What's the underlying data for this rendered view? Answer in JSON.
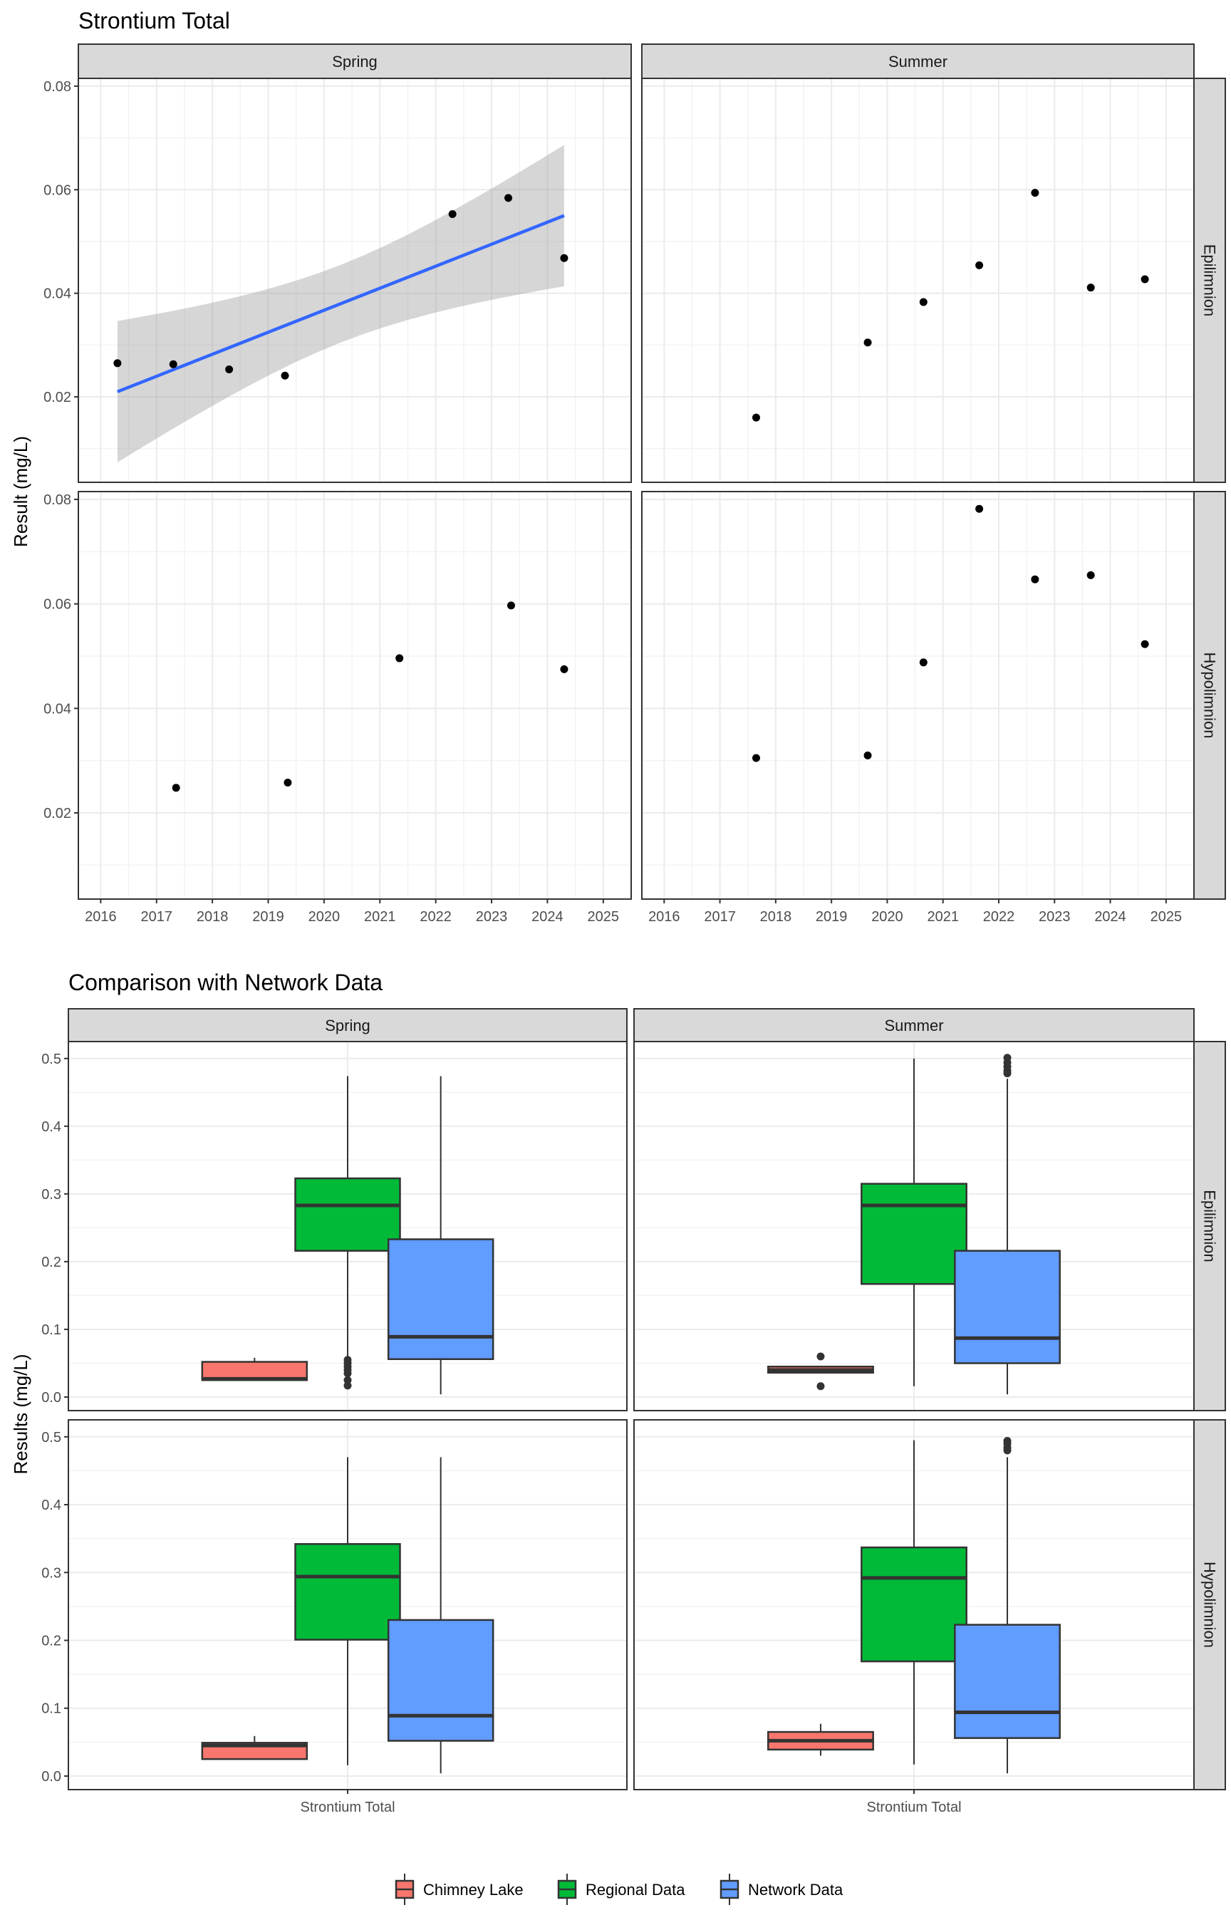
{
  "chart_data": [
    {
      "type": "scatter",
      "title": "Strontium Total",
      "ylabel": "Result (mg/L)",
      "xlabel": "",
      "xlim": [
        2015.6,
        2025.5
      ],
      "ylim": [
        0.0035,
        0.0815
      ],
      "x_ticks": [
        "2016",
        "2017",
        "2018",
        "2019",
        "2020",
        "2021",
        "2022",
        "2023",
        "2024",
        "2025"
      ],
      "y_ticks": [
        "0.02",
        "0.04",
        "0.06",
        "0.08"
      ],
      "grid": true,
      "col_facets": [
        "Spring",
        "Summer"
      ],
      "row_facets": [
        "Epilimnion",
        "Hypolimnion"
      ],
      "panels": [
        {
          "col": "Spring",
          "row": "Epilimnion",
          "points": [
            [
              2016.3,
              0.0265
            ],
            [
              2017.3,
              0.0263
            ],
            [
              2018.3,
              0.0253
            ],
            [
              2019.3,
              0.0241
            ],
            [
              2022.3,
              0.0553
            ],
            [
              2023.3,
              0.0584
            ],
            [
              2024.3,
              0.0468
            ]
          ],
          "trend": {
            "method": "lm",
            "color": "#3366FF",
            "x": [
              2016.3,
              2024.3
            ],
            "y": [
              0.021,
              0.055
            ],
            "ci_lower": [
              0.0077,
              0.041
            ],
            "ci_upper": [
              0.0345,
              0.0688
            ],
            "ci_mid": [
              [
                2020.3,
                0.0305,
                0.0455
              ]
            ]
          }
        },
        {
          "col": "Summer",
          "row": "Epilimnion",
          "points": [
            [
              2017.65,
              0.016
            ],
            [
              2019.65,
              0.0305
            ],
            [
              2020.65,
              0.0383
            ],
            [
              2021.65,
              0.0454
            ],
            [
              2022.65,
              0.0594
            ],
            [
              2023.65,
              0.0411
            ],
            [
              2024.62,
              0.0427
            ]
          ]
        },
        {
          "col": "Spring",
          "row": "Hypolimnion",
          "points": [
            [
              2017.35,
              0.0248
            ],
            [
              2019.35,
              0.0258
            ],
            [
              2021.35,
              0.0496
            ],
            [
              2023.35,
              0.0597
            ],
            [
              2024.3,
              0.0475
            ]
          ]
        },
        {
          "col": "Summer",
          "row": "Hypolimnion",
          "points": [
            [
              2017.65,
              0.0305
            ],
            [
              2019.65,
              0.031
            ],
            [
              2020.65,
              0.0488
            ],
            [
              2021.65,
              0.0782
            ],
            [
              2022.65,
              0.0647
            ],
            [
              2023.65,
              0.0655
            ],
            [
              2024.62,
              0.0523
            ]
          ]
        }
      ]
    },
    {
      "type": "box",
      "title": "Comparison with Network Data",
      "ylabel": "Results (mg/L)",
      "xlabel": "",
      "categories": [
        "Strontium Total"
      ],
      "ylim": [
        -0.02,
        0.525
      ],
      "y_ticks": [
        "0.0",
        "0.1",
        "0.2",
        "0.3",
        "0.4",
        "0.5"
      ],
      "grid": true,
      "col_facets": [
        "Spring",
        "Summer"
      ],
      "row_facets": [
        "Epilimnion",
        "Hypolimnion"
      ],
      "legend": {
        "position": "bottom",
        "entries": [
          {
            "name": "Chimney Lake",
            "color": "#F8766D"
          },
          {
            "name": "Regional Data",
            "color": "#00BA38"
          },
          {
            "name": "Network Data",
            "color": "#619CFF"
          }
        ]
      },
      "panels": [
        {
          "col": "Spring",
          "row": "Epilimnion",
          "series": [
            {
              "name": "Chimney Lake",
              "min": 0.025,
              "q1": 0.025,
              "median": 0.027,
              "q3": 0.052,
              "max": 0.058,
              "outliers": []
            },
            {
              "name": "Regional Data",
              "min": 0.06,
              "q1": 0.216,
              "median": 0.283,
              "q3": 0.323,
              "max": 0.474,
              "outliers": [
                0.017,
                0.025,
                0.035,
                0.04,
                0.045,
                0.05,
                0.055
              ]
            },
            {
              "name": "Network Data",
              "min": 0.004,
              "q1": 0.056,
              "median": 0.089,
              "q3": 0.233,
              "max": 0.474,
              "outliers": []
            }
          ]
        },
        {
          "col": "Summer",
          "row": "Epilimnion",
          "series": [
            {
              "name": "Chimney Lake",
              "min": 0.036,
              "q1": 0.036,
              "median": 0.04,
              "q3": 0.045,
              "max": 0.045,
              "outliers": [
                0.016,
                0.06
              ]
            },
            {
              "name": "Regional Data",
              "min": 0.016,
              "q1": 0.167,
              "median": 0.283,
              "q3": 0.315,
              "max": 0.5,
              "outliers": []
            },
            {
              "name": "Network Data",
              "min": 0.004,
              "q1": 0.05,
              "median": 0.087,
              "q3": 0.216,
              "max": 0.47,
              "outliers": [
                0.478,
                0.482,
                0.488,
                0.494,
                0.501
              ]
            }
          ]
        },
        {
          "col": "Spring",
          "row": "Hypolimnion",
          "series": [
            {
              "name": "Chimney Lake",
              "min": 0.025,
              "q1": 0.025,
              "median": 0.045,
              "q3": 0.049,
              "max": 0.059,
              "outliers": []
            },
            {
              "name": "Regional Data",
              "min": 0.016,
              "q1": 0.201,
              "median": 0.294,
              "q3": 0.342,
              "max": 0.47,
              "outliers": []
            },
            {
              "name": "Network Data",
              "min": 0.004,
              "q1": 0.052,
              "median": 0.089,
              "q3": 0.23,
              "max": 0.47,
              "outliers": []
            }
          ]
        },
        {
          "col": "Summer",
          "row": "Hypolimnion",
          "series": [
            {
              "name": "Chimney Lake",
              "min": 0.03,
              "q1": 0.039,
              "median": 0.052,
              "q3": 0.065,
              "max": 0.077,
              "outliers": []
            },
            {
              "name": "Regional Data",
              "min": 0.017,
              "q1": 0.169,
              "median": 0.292,
              "q3": 0.337,
              "max": 0.495,
              "outliers": []
            },
            {
              "name": "Network Data",
              "min": 0.004,
              "q1": 0.056,
              "median": 0.094,
              "q3": 0.223,
              "max": 0.47,
              "outliers": [
                0.48,
                0.484,
                0.49,
                0.494
              ]
            }
          ]
        }
      ]
    }
  ]
}
